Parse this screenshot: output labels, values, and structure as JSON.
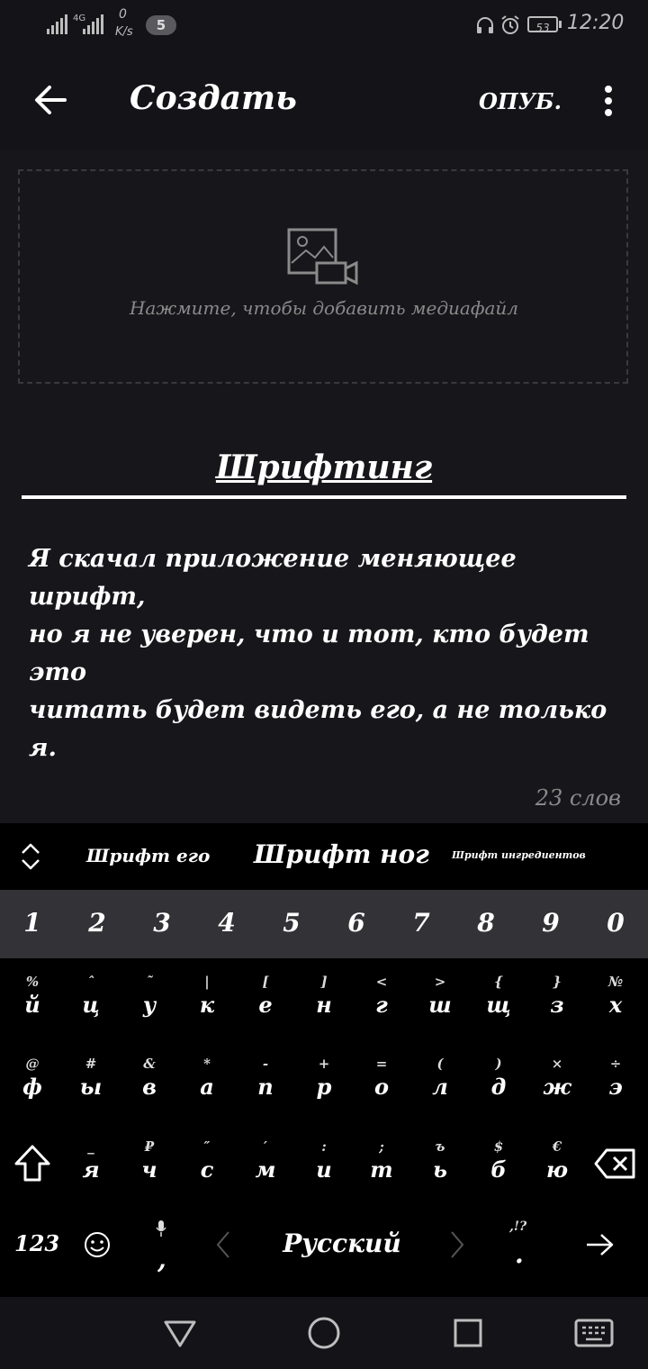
{
  "status_bar": {
    "network": "4G",
    "speed_value": "0",
    "speed_unit": "K/s",
    "notification_count": "5",
    "battery": "53",
    "time": "12:20"
  },
  "app_bar": {
    "title": "Создать",
    "publish_label": "ОПУБ."
  },
  "editor": {
    "media_placeholder": "Нажмите, чтобы добавить медиафайл",
    "post_title": "Шрифтинг",
    "body_lines": [
      "Я скачал приложение меняющее шрифт,",
      "но я не уверен, что и тот, кто будет это",
      "читать будет видеть его, а не только я."
    ],
    "word_count": "23 слов"
  },
  "suggestions": [
    "Шрифт его",
    "Шрифт ног",
    "Шрифт ингредиентов"
  ],
  "keyboard": {
    "numbers": [
      "1",
      "2",
      "3",
      "4",
      "5",
      "6",
      "7",
      "8",
      "9",
      "0"
    ],
    "row1": [
      {
        "alt": "%",
        "main": "й"
      },
      {
        "alt": "ˆ",
        "main": "ц"
      },
      {
        "alt": "˜",
        "main": "у"
      },
      {
        "alt": "|",
        "main": "к"
      },
      {
        "alt": "[",
        "main": "е"
      },
      {
        "alt": "]",
        "main": "н"
      },
      {
        "alt": "<",
        "main": "г"
      },
      {
        "alt": ">",
        "main": "ш"
      },
      {
        "alt": "{",
        "main": "щ"
      },
      {
        "alt": "}",
        "main": "з"
      },
      {
        "alt": "№",
        "main": "х"
      }
    ],
    "row2": [
      {
        "alt": "@",
        "main": "ф"
      },
      {
        "alt": "#",
        "main": "ы"
      },
      {
        "alt": "&",
        "main": "в"
      },
      {
        "alt": "*",
        "main": "а"
      },
      {
        "alt": "-",
        "main": "п"
      },
      {
        "alt": "+",
        "main": "р"
      },
      {
        "alt": "=",
        "main": "о"
      },
      {
        "alt": "(",
        "main": "л"
      },
      {
        "alt": ")",
        "main": "д"
      },
      {
        "alt": "×",
        "main": "ж"
      },
      {
        "alt": "÷",
        "main": "э"
      }
    ],
    "row3": [
      {
        "alt": "_",
        "main": "я"
      },
      {
        "alt": "₽",
        "main": "ч"
      },
      {
        "alt": "″",
        "main": "с"
      },
      {
        "alt": "′",
        "main": "м"
      },
      {
        "alt": ":",
        "main": "и"
      },
      {
        "alt": ";",
        "main": "т"
      },
      {
        "alt": "ъ",
        "main": "ь"
      },
      {
        "alt": "$",
        "main": "б"
      },
      {
        "alt": "€",
        "main": "ю"
      }
    ],
    "symbols_label": "123",
    "comma": ",",
    "space_label": "Русский",
    "period_alt": ",!?",
    "period": "."
  },
  "icons": {
    "back": "arrow-left-icon",
    "more": "more-vertical-icon",
    "media": "image-video-icon",
    "expand": "chevron-up-down-icon",
    "shift": "shift-icon",
    "backspace": "backspace-icon",
    "emoji": "emoji-icon",
    "mic": "mic-icon",
    "enter": "arrow-right-icon"
  }
}
